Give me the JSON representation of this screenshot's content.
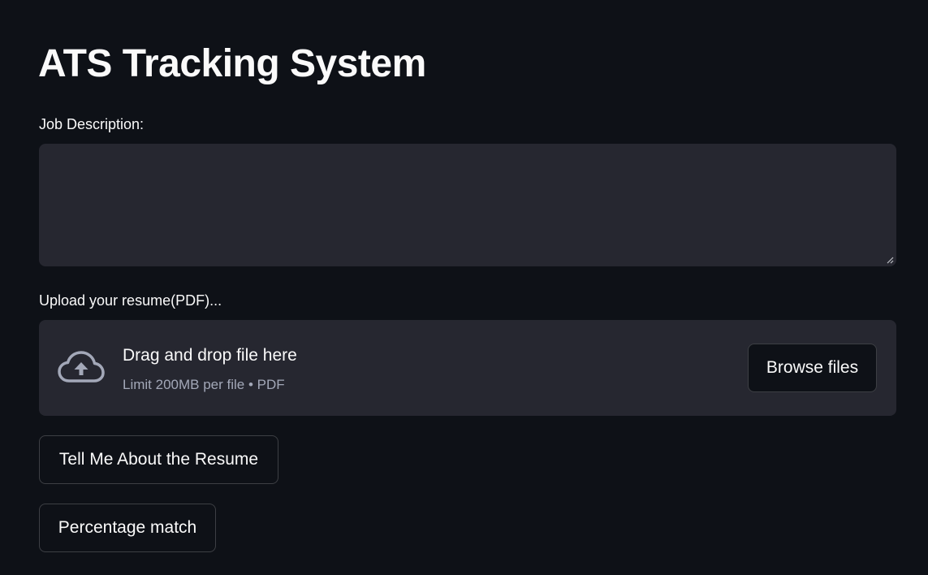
{
  "page": {
    "title": "ATS Tracking System"
  },
  "job_description": {
    "label": "Job Description:",
    "value": ""
  },
  "uploader": {
    "label": "Upload your resume(PDF)...",
    "drop_text": "Drag and drop file here",
    "limit_text": "Limit 200MB per file • PDF",
    "browse_label": "Browse files",
    "icon": "cloud-upload-icon"
  },
  "actions": {
    "tell_me_label": "Tell Me About the Resume",
    "percentage_label": "Percentage match"
  },
  "colors": {
    "background": "#0e1117",
    "input_background": "#262730",
    "text": "#fafafa",
    "muted_text": "#a3a8b8",
    "icon": "#a3a8b8"
  }
}
